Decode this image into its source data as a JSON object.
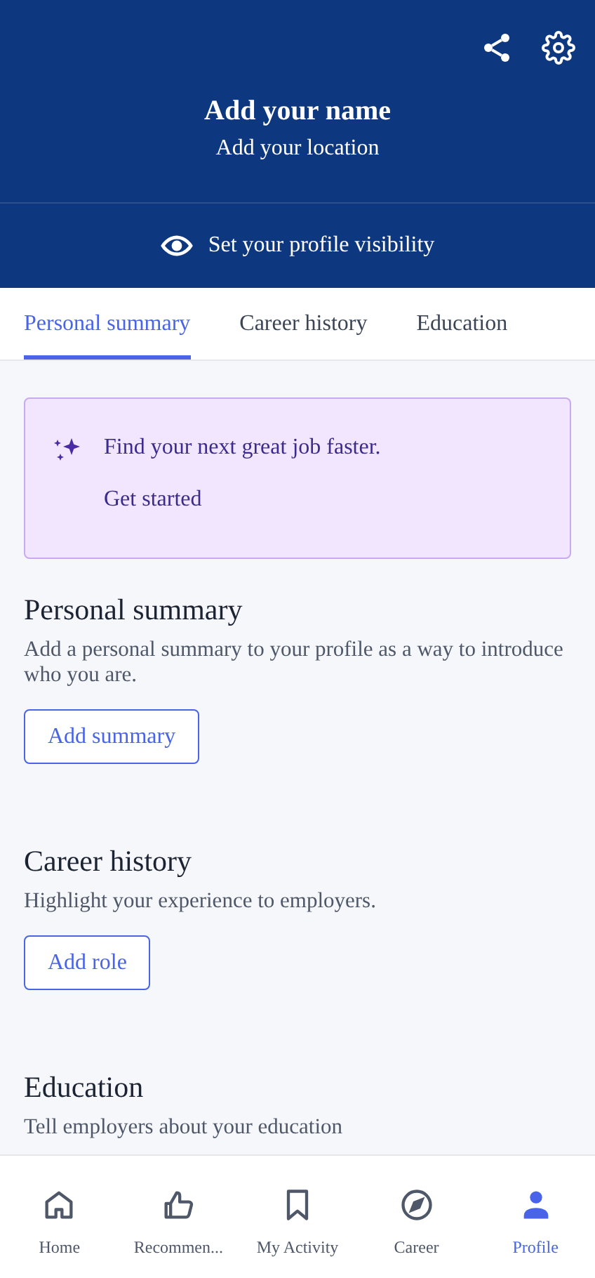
{
  "header": {
    "name": "Add your name",
    "location": "Add your location",
    "visibility_label": "Set your profile visibility"
  },
  "tabs": [
    {
      "label": "Personal summary",
      "selected": true
    },
    {
      "label": "Career history",
      "selected": false
    },
    {
      "label": "Education",
      "selected": false
    }
  ],
  "banner": {
    "message": "Find your next great job faster.",
    "action": "Get started"
  },
  "sections": [
    {
      "title": "Personal summary",
      "description": "Add a personal summary to your profile as a way to introduce who you are.",
      "button": "Add summary"
    },
    {
      "title": "Career history",
      "description": "Highlight your experience to employers.",
      "button": "Add role"
    },
    {
      "title": "Education",
      "description": "Tell employers about your education"
    }
  ],
  "nav": [
    {
      "kind": "home",
      "label": "Home",
      "selected": false
    },
    {
      "kind": "thumb",
      "label": "Recommen...",
      "selected": false
    },
    {
      "kind": "bookmark",
      "label": "My Activity",
      "selected": false
    },
    {
      "kind": "compass",
      "label": "Career",
      "selected": false
    },
    {
      "kind": "person",
      "label": "Profile",
      "selected": true
    }
  ]
}
